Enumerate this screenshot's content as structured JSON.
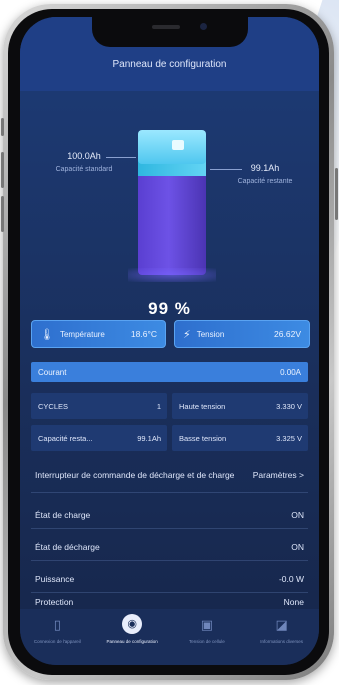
{
  "header": {
    "title": "Panneau de configuration"
  },
  "battery": {
    "standard_capacity_value": "100.0Ah",
    "standard_capacity_label": "Capacité standard",
    "remaining_capacity_value": "99.1Ah",
    "remaining_capacity_label": "Capacité restante",
    "percent": "99 %"
  },
  "metrics": {
    "temperature_label": "Température",
    "temperature_value": "18.6°C",
    "tension_label": "Tension",
    "tension_value": "26.62V"
  },
  "courant": {
    "label": "Courant",
    "value": "0.00A"
  },
  "grid": {
    "cycles_label": "CYCLES",
    "cycles_value": "1",
    "high_voltage_label": "Haute tension",
    "high_voltage_value": "3.330 V",
    "remaining_cap_label": "Capacité resta...",
    "remaining_cap_value": "99.1Ah",
    "low_voltage_label": "Basse tension",
    "low_voltage_value": "3.325 V"
  },
  "switch_row": {
    "label": "Interrupteur de commande de décharge et de charge",
    "action": "Paramètres",
    "chevron": ">"
  },
  "status": [
    {
      "label": "État de charge",
      "value": "ON"
    },
    {
      "label": "État de décharge",
      "value": "ON"
    },
    {
      "label": "Puissance",
      "value": "-0.0 W"
    },
    {
      "label": "Protection",
      "value": "None"
    }
  ],
  "tabs": [
    {
      "label": "Connexion de l'appareil",
      "icon": "device-icon"
    },
    {
      "label": "Panneau de configuration",
      "icon": "dashboard-icon",
      "active": true
    },
    {
      "label": "Tension de cellule",
      "icon": "cell-icon"
    },
    {
      "label": "Informations diverses",
      "icon": "info-icon"
    }
  ]
}
